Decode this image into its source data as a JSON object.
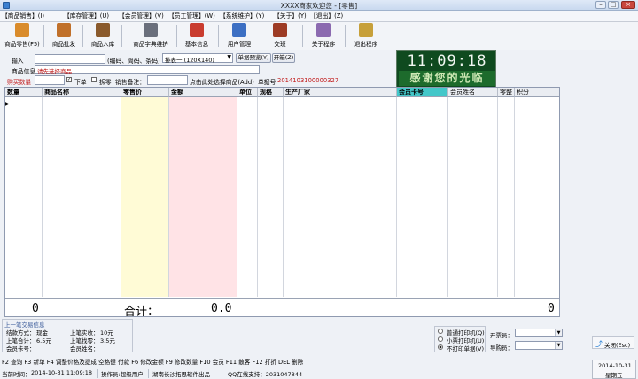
{
  "window": {
    "title": "XXXX商家欢迎您 - [零售]"
  },
  "menu": [
    "【商品销售】(I)",
    "【库存管理】(U)",
    "【会员管理】(V)",
    "【员工管理】(W)",
    "【系统维护】(Y)",
    "【关于】(Y)",
    "【退出】(Z)"
  ],
  "toolbar": [
    {
      "label": "商品零售(F5)",
      "icon": "retail-icon",
      "color": "#d98b2b"
    },
    {
      "label": "商品批发",
      "icon": "wholesale-icon",
      "color": "#c0702a"
    },
    {
      "label": "商品入库",
      "icon": "stock-in-icon",
      "color": "#8a5a2c"
    },
    {
      "label": "商品字典维护",
      "icon": "dictionary-icon",
      "color": "#6a6f7c"
    },
    {
      "label": "基本信息",
      "icon": "info-icon",
      "color": "#c93c2f"
    },
    {
      "label": "用户管理",
      "icon": "users-icon",
      "color": "#3c6fc3"
    },
    {
      "label": "交班",
      "icon": "shift-icon",
      "color": "#9d3b25"
    },
    {
      "label": "关于程序",
      "icon": "about-icon",
      "color": "#8b6ab0"
    },
    {
      "label": "退出程序",
      "icon": "exit-icon",
      "color": "#c7a03a"
    }
  ],
  "input": {
    "label": "输入",
    "hint": "(编码、简码、条码)",
    "ticket_option": "排表一 (120X140)",
    "preview_btn": "单据预览(Y)",
    "cashbox_btn": "开箱(Z)"
  },
  "product": {
    "label": "商品信息",
    "value": "请先选择商品"
  },
  "purchase": {
    "qty_label": "购买数量",
    "order_label": "下单",
    "split_label": "拆零",
    "remark_label": "销售备注：",
    "pick_label": "点击此处选择商品(Add)",
    "doc_label": "单据号",
    "doc_no": "2014103100000327"
  },
  "clock": {
    "time": "11:09:18",
    "thanks": "感谢您的光临"
  },
  "table": {
    "columns": [
      "数量",
      "商品名称",
      "零售价",
      "金额",
      "单位",
      "规格",
      "生产厂家",
      "会员卡号",
      "会员姓名",
      "零整",
      "积分"
    ],
    "total_qty": "0",
    "total_label": "合计：",
    "total_amount": "0.0",
    "total_points": "0"
  },
  "last": {
    "title": "上一笔交易信息",
    "pay_method_label": "结款方式：",
    "pay_method": "现金",
    "last_paid_label": "上笔实收：",
    "last_paid": "10元",
    "last_total_label": "上笔合计：",
    "last_total": "6.5元",
    "last_change_label": "上笔找零：",
    "last_change": "3.5元",
    "member_card_label": "会员卡号：",
    "member_name_label": "会员姓名："
  },
  "print": {
    "options": [
      "普通打印机(Q)",
      "小票打印机(U)",
      "不打印单据(V)"
    ],
    "selected": 2
  },
  "staff": {
    "issuer_label": "开票员：",
    "guide_label": "导购员："
  },
  "close_btn": "关闭(Esc)",
  "shortcuts": "F2 查询 F3 新单 F4 调整价格及提成 空格键 付款 F6 修改金额  F9 修改数量 F10 会员 F11 散客 F12 打折 DEL 删除",
  "status": {
    "time_label": "当前时间：",
    "time": "2014-10-31 11:09:18",
    "operator": "操作员:超级用户",
    "company": "湖南长沙拓思软件出品",
    "qq": "QQ在线支持：2031047844",
    "date": "2014-10-31",
    "weekday": "星期五"
  }
}
